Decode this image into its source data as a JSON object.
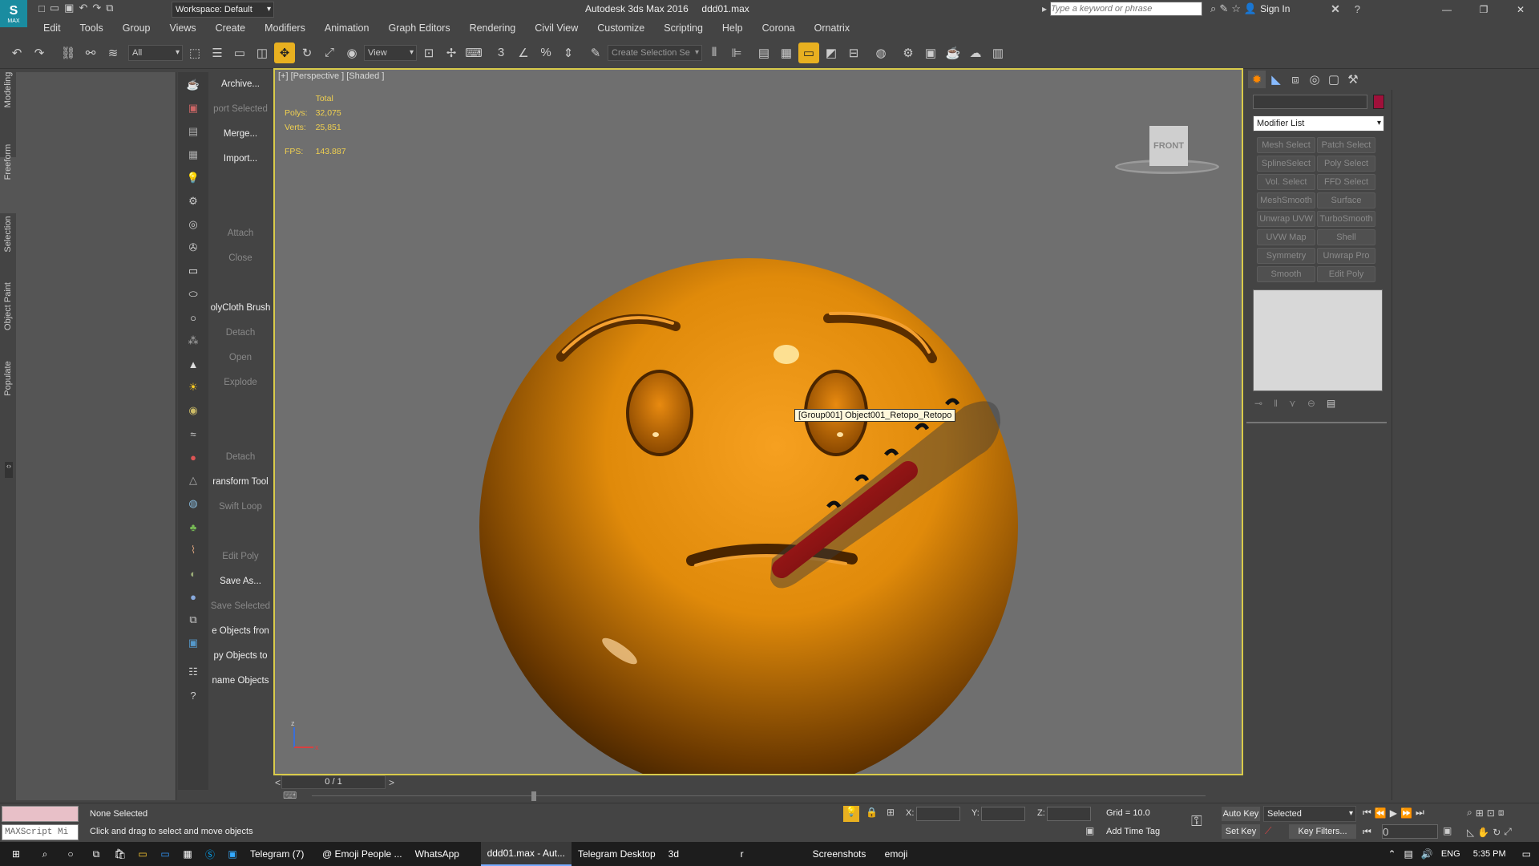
{
  "titlebar": {
    "workspace": "Workspace: Default",
    "app_title": "Autodesk 3ds Max 2016",
    "file_name": "ddd01.max",
    "search_placeholder": "Type a keyword or phrase",
    "sign_in": "Sign In",
    "logo_label": "MAX"
  },
  "menu": [
    "Edit",
    "Tools",
    "Group",
    "Views",
    "Create",
    "Modifiers",
    "Animation",
    "Graph Editors",
    "Rendering",
    "Civil View",
    "Customize",
    "Scripting",
    "Help",
    "Corona",
    "Ornatrix"
  ],
  "toolbar": {
    "filter_value": "All",
    "ref_coord_value": "View",
    "selection_set_placeholder": "Create Selection Se"
  },
  "left_tabs": [
    "Modeling",
    "Freeform",
    "Selection",
    "Object Paint",
    "Populate"
  ],
  "labels": [
    {
      "text": "Archive...",
      "dim": false
    },
    {
      "text": "port Selected",
      "dim": true
    },
    {
      "text": "Merge...",
      "dim": false
    },
    {
      "text": "Import...",
      "dim": false
    },
    {
      "text": "",
      "dim": false
    },
    {
      "text": "",
      "dim": false
    },
    {
      "text": "Attach",
      "dim": true
    },
    {
      "text": "Close",
      "dim": true
    },
    {
      "text": "",
      "dim": false
    },
    {
      "text": "olyCloth Brush",
      "dim": false
    },
    {
      "text": "Detach",
      "dim": true
    },
    {
      "text": "Open",
      "dim": true
    },
    {
      "text": "Explode",
      "dim": true
    },
    {
      "text": "",
      "dim": false
    },
    {
      "text": "",
      "dim": false
    },
    {
      "text": "Detach",
      "dim": true
    },
    {
      "text": "ransform Tool",
      "dim": false
    },
    {
      "text": "Swift Loop",
      "dim": true
    },
    {
      "text": "",
      "dim": false
    },
    {
      "text": "Edit Poly",
      "dim": true
    },
    {
      "text": "Save As...",
      "dim": false
    },
    {
      "text": "Save Selected",
      "dim": true
    },
    {
      "text": "e Objects fron",
      "dim": false
    },
    {
      "text": "py Objects to",
      "dim": false
    },
    {
      "text": "name Objects",
      "dim": false
    }
  ],
  "viewport": {
    "label": "[+] [Perspective ] [Shaded ]",
    "stats_total": "Total",
    "polys_label": "Polys:",
    "polys_value": "32,075",
    "verts_label": "Verts:",
    "verts_value": "25,851",
    "fps_label": "FPS:",
    "fps_value": "143.887",
    "viewcube_label": "FRONT",
    "tooltip": "[Group001] Object001_Retopo_Retopo",
    "axis_z": "z",
    "axis_x": "x",
    "face_color": "#e08a0a",
    "thermometer_color": "#8a1010"
  },
  "modifier_panel": {
    "color_swatch": "#a0103a",
    "modifier_list_label": "Modifier List",
    "modifiers": [
      "Mesh Select",
      "Patch Select",
      "SplineSelect",
      "Poly Select",
      "Vol. Select",
      "FFD Select",
      "MeshSmooth",
      "Surface Select",
      "Unwrap UVW",
      "TurboSmooth",
      "UVW Map",
      "Shell",
      "Symmetry",
      "Unwrap Pro",
      "Smooth",
      "Edit Poly"
    ]
  },
  "timeline": {
    "frame": "0 / 1"
  },
  "status": {
    "maxscript": "MAXScript Mi",
    "selection": "None Selected",
    "prompt": "Click and drag to select and move objects",
    "x_label": "X:",
    "y_label": "Y:",
    "z_label": "Z:",
    "grid": "Grid = 10.0",
    "add_time_tag": "Add Time Tag",
    "auto_key": "Auto Key",
    "set_key": "Set Key",
    "key_mode": "Selected",
    "key_filters": "Key Filters...",
    "frame_value": "0"
  },
  "taskbar": {
    "items": [
      {
        "label": "Telegram (7)",
        "active": false
      },
      {
        "label": "@ Emoji People ...",
        "active": false
      },
      {
        "label": "WhatsApp",
        "active": false
      },
      {
        "label": "ddd01.max - Aut...",
        "active": true
      },
      {
        "label": "Telegram Desktop",
        "active": false
      },
      {
        "label": "3d",
        "active": false
      },
      {
        "label": "r",
        "active": false
      },
      {
        "label": "Screenshots",
        "active": false
      },
      {
        "label": "emoji",
        "active": false
      }
    ],
    "lang": "ENG",
    "time": "5:35 PM"
  }
}
